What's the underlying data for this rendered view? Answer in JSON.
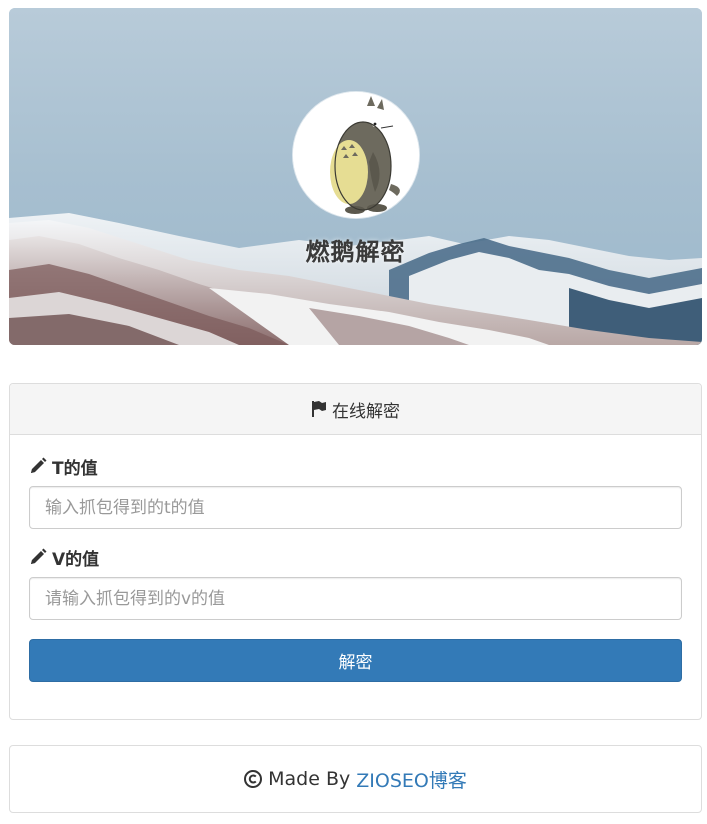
{
  "hero": {
    "title": "燃鹅解密"
  },
  "panel": {
    "heading": "在线解密",
    "t_label": "T的值",
    "t_placeholder": "输入抓包得到的t的值",
    "t_value": "",
    "v_label": "V的值",
    "v_placeholder": "请输入抓包得到的v的值",
    "v_value": "",
    "submit_label": "解密"
  },
  "footer": {
    "made_by": "Made By",
    "link_text": "ZIOSEO博客"
  },
  "colors": {
    "primary": "#337ab7",
    "link": "#337ab7",
    "panel_heading_bg": "#f5f5f5"
  },
  "icons": {
    "heading_icon": "flag-icon",
    "label_icon": "pencil-icon",
    "footer_icon": "copyright-icon"
  }
}
